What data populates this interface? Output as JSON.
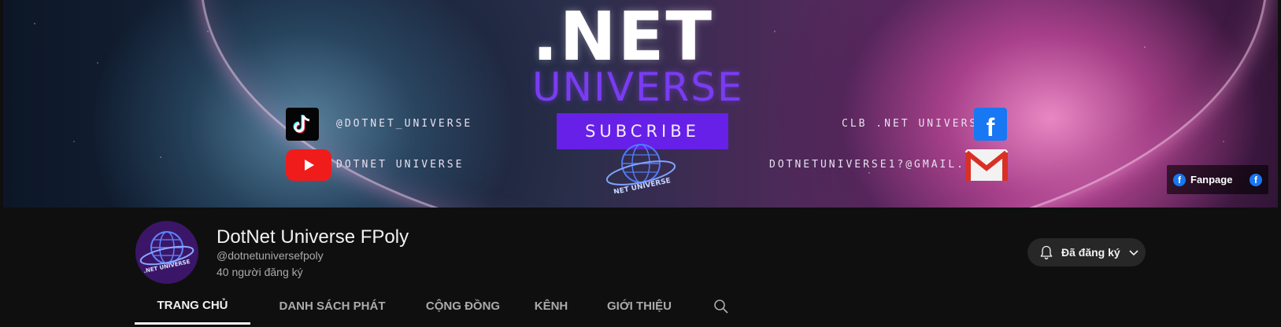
{
  "banner": {
    "title_main": ".NET",
    "title_sub": "UNIVERSE",
    "cta": "SUBCRIBE",
    "globe_text": ".NET UNIVERSE",
    "tiktok_handle": "@DOTNET_UNIVERSE",
    "youtube_name": "DOTNET UNIVERSE",
    "facebook_name": "CLB .NET UNIVERSE",
    "email": "DOTNETUNIVERSE1?@GMAIL.COM",
    "links": {
      "fanpage_label": "Fanpage"
    }
  },
  "channel": {
    "avatar_text": ".NET UNIVERSE",
    "name": "DotNet Universe FPoly",
    "handle": "@dotnetuniversefpoly",
    "subscribers": "40 người đăng ký",
    "subscribe_button": "Đã đăng ký"
  },
  "tabs": [
    {
      "label": "TRANG CHỦ",
      "active": true
    },
    {
      "label": "DANH SÁCH PHÁT",
      "active": false
    },
    {
      "label": "CỘNG ĐỒNG",
      "active": false
    },
    {
      "label": "KÊNH",
      "active": false
    },
    {
      "label": "GIỚI THIỆU",
      "active": false
    }
  ],
  "icons": [
    "tiktok-icon",
    "youtube-icon",
    "facebook-icon",
    "gmail-icon",
    "globe-icon",
    "bell-icon",
    "chevron-down-icon",
    "search-icon"
  ],
  "colors": {
    "brand_purple": "#6620e8",
    "universe_text": "#7a3cf2",
    "page_bg": "#0f0f0f"
  }
}
